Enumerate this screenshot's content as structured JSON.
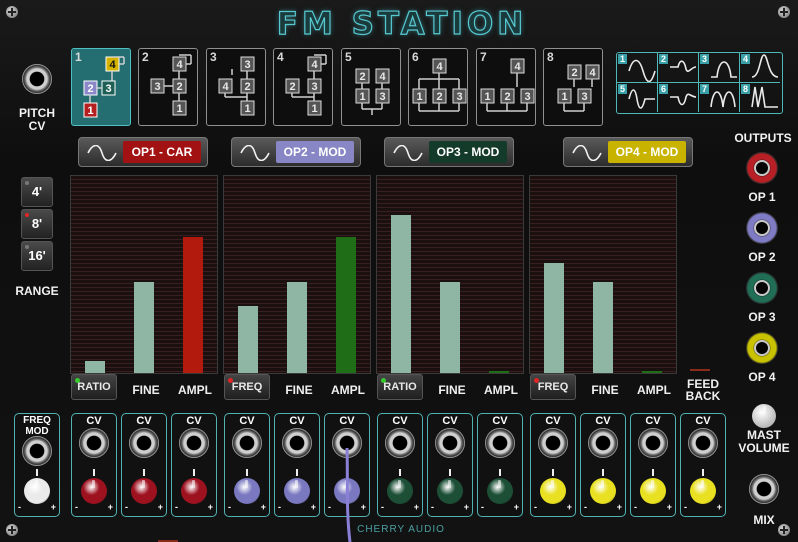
{
  "title": "FM STATION",
  "brand": "CHERRY AUDIO",
  "pitch_cv_label": "PITCH\nCV",
  "algorithms": [
    {
      "num": "1",
      "selected": true
    },
    {
      "num": "2",
      "selected": false
    },
    {
      "num": "3",
      "selected": false
    },
    {
      "num": "4",
      "selected": false
    },
    {
      "num": "5",
      "selected": false
    },
    {
      "num": "6",
      "selected": false
    },
    {
      "num": "7",
      "selected": false
    },
    {
      "num": "8",
      "selected": false
    }
  ],
  "waveform_numbers": [
    "1",
    "2",
    "3",
    "4",
    "5",
    "6",
    "7",
    "8"
  ],
  "operators": [
    {
      "label": "OP1 - CAR",
      "color": "#a31212",
      "text_color": "#ffffff",
      "button": "RATIO",
      "button_led": "#37c82d",
      "fine": 0.46,
      "ampl": 0.69,
      "base": 0.06,
      "ampl_color": "#b21a0e"
    },
    {
      "label": "OP2 - MOD",
      "color": "#8886c4",
      "text_color": "#ffffff",
      "button": "FREQ",
      "button_led": "#e02626",
      "fine": 0.46,
      "ampl": 0.69,
      "base": 0.34,
      "ampl_color": "#1f6e17"
    },
    {
      "label": "OP3 - MOD",
      "color": "#143a2a",
      "text_color": "#ffffff",
      "button": "RATIO",
      "button_led": "#37c82d",
      "fine": 0.46,
      "ampl": 0.0,
      "base": 0.8,
      "ampl_color": "#1f6e17"
    },
    {
      "label": "OP4 - MOD",
      "color": "#c8b400",
      "text_color": "#ffffff",
      "button": "FREQ",
      "button_led": "#e02626",
      "fine": 0.46,
      "ampl": 0.0,
      "base": 0.56,
      "ampl_color": "#1f6e17"
    }
  ],
  "param_labels": {
    "fine": "FINE",
    "ampl": "AMPL",
    "feedback": "FEED\nBACK"
  },
  "range": {
    "label": "RANGE",
    "buttons": [
      "4'",
      "8'",
      "16'"
    ],
    "active": "8'"
  },
  "outputs": {
    "title": "OUTPUTS",
    "jacks": [
      {
        "label": "OP 1",
        "ring": "#b82026"
      },
      {
        "label": "OP 2",
        "ring": "#7f7bc4"
      },
      {
        "label": "OP 3",
        "ring": "#1f6e55"
      },
      {
        "label": "OP 4",
        "ring": "#c8c200"
      }
    ]
  },
  "freq_mod_label": "FREQ\nMOD",
  "cv_label": "CV",
  "minus": "-",
  "plus": "+",
  "cv_modules": [
    {
      "knob": "#eaeaea"
    },
    {
      "knob": "#9e1220"
    },
    {
      "knob": "#9e1220"
    },
    {
      "knob": "#9e1220"
    },
    {
      "knob": "#7a78c0"
    },
    {
      "knob": "#7a78c0"
    },
    {
      "knob": "#7a78c0"
    },
    {
      "knob": "#1c4f36"
    },
    {
      "knob": "#1c4f36"
    },
    {
      "knob": "#1c4f36"
    },
    {
      "knob": "#e8e020"
    },
    {
      "knob": "#e8e020"
    },
    {
      "knob": "#e8e020"
    },
    {
      "knob": "#e8e020"
    }
  ],
  "master_volume_label": "MAST\nVOLUME",
  "mix_label": "MIX",
  "colors": {
    "accent": "#4fc1c4",
    "algo_selected": "#246e71"
  }
}
